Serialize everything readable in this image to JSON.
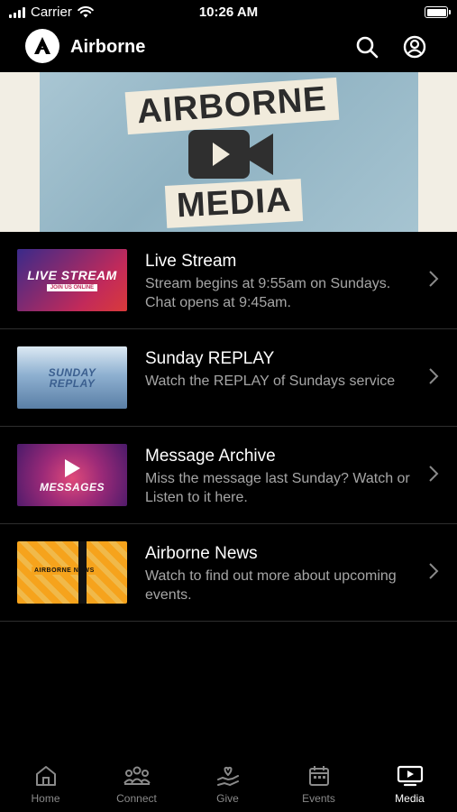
{
  "status_bar": {
    "carrier": "Carrier",
    "time": "10:26 AM"
  },
  "header": {
    "title": "Airborne"
  },
  "hero": {
    "line1": "AIRBORNE",
    "line2": "MEDIA"
  },
  "items": [
    {
      "title": "Live Stream",
      "description": "Stream begins at 9:55am on Sundays. Chat opens at 9:45am.",
      "thumb_text": "LIVE STREAM",
      "thumb_sub": "JOIN US ONLINE"
    },
    {
      "title": "Sunday REPLAY",
      "description": "Watch the REPLAY of Sundays service",
      "thumb_text": "SUNDAY REPLAY"
    },
    {
      "title": "Message Archive",
      "description": "Miss the message last Sunday? Watch or Listen to it here.",
      "thumb_text": "MESSAGES"
    },
    {
      "title": "Airborne News",
      "description": "Watch to find out more about upcoming events.",
      "thumb_text": "AIRBORNE NEWS"
    }
  ],
  "tabs": [
    {
      "label": "Home",
      "icon": "home-icon"
    },
    {
      "label": "Connect",
      "icon": "people-icon"
    },
    {
      "label": "Give",
      "icon": "give-icon"
    },
    {
      "label": "Events",
      "icon": "calendar-icon"
    },
    {
      "label": "Media",
      "icon": "media-icon",
      "active": true
    }
  ]
}
